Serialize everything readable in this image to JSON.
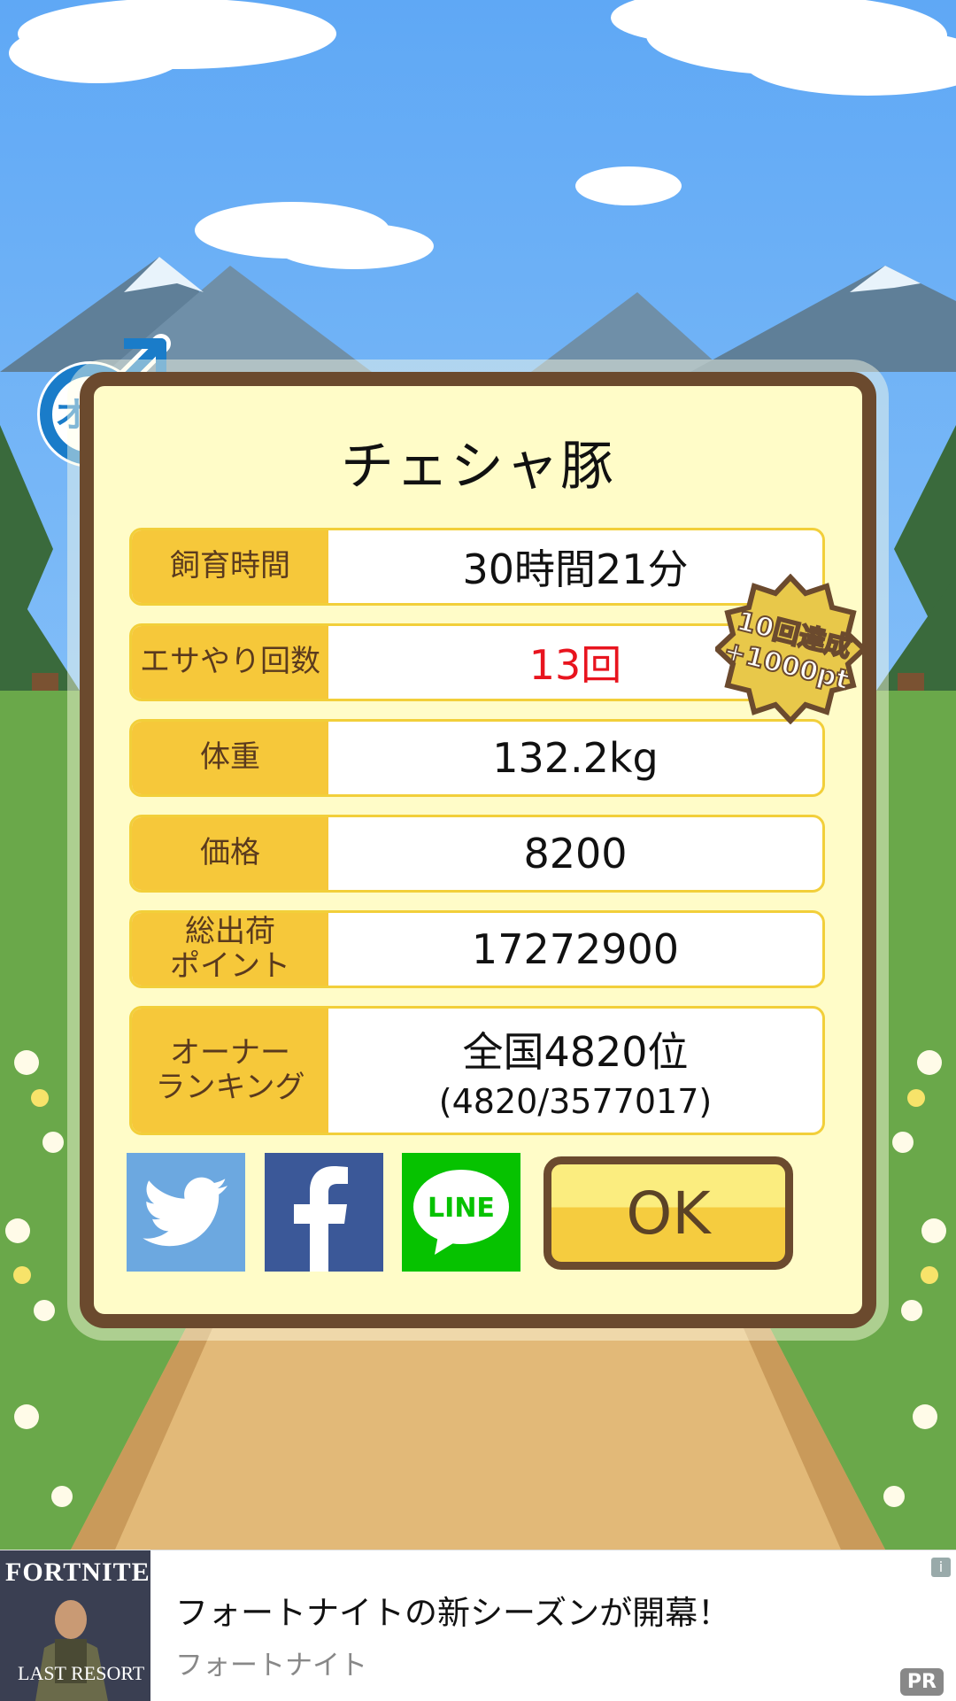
{
  "pig": {
    "name": "チェシャ豚",
    "gender_label": "オス"
  },
  "stats": [
    {
      "label": "飼育時間",
      "value": "30時間21分"
    },
    {
      "label": "エサやり回数",
      "value": "13回"
    },
    {
      "label": "体重",
      "value": "132.2kg"
    },
    {
      "label": "価格",
      "value": "8200"
    },
    {
      "label": "総出荷\nポイント",
      "value": "17272900"
    },
    {
      "label": "オーナー\nランキング",
      "value": "全国4820位",
      "sub": "(4820/3577017)"
    }
  ],
  "badge": {
    "line1": "10回達成",
    "line2": "+1000pt"
  },
  "share": {
    "line_label": "LINE"
  },
  "ok_label": "OK",
  "ad": {
    "thumb_title": "FORTNITE",
    "thumb_caption": "LAST RESORT",
    "headline": "フォートナイトの新シーズンが開幕！",
    "sponsor": "フォートナイト",
    "pr_label": "PR",
    "info_label": "i"
  },
  "colors": {
    "accent": "#f6c83a",
    "frame": "#6b4a2e",
    "highlight": "#e8141e",
    "gender": "#1a7cc9"
  }
}
